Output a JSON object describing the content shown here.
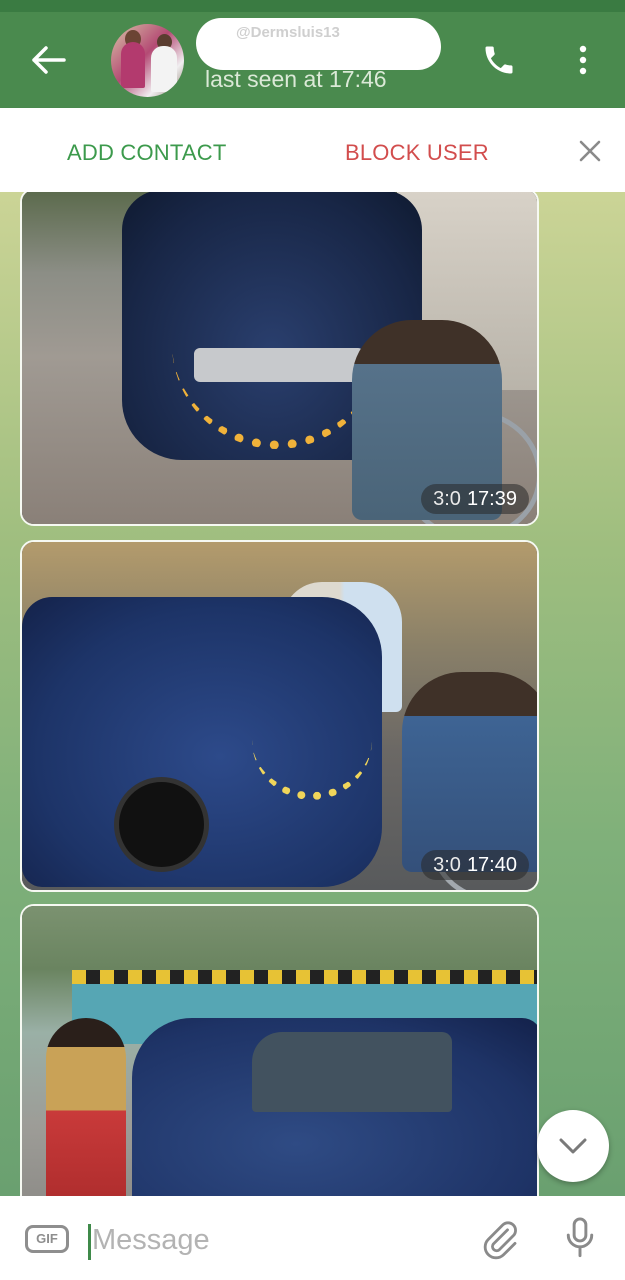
{
  "header": {
    "contact_name": "@Dermsluis13",
    "last_seen": "last seen at 17:46"
  },
  "action_bar": {
    "add_contact": "ADD CONTACT",
    "block_user": "BLOCK USER"
  },
  "messages": [
    {
      "type": "video",
      "duration": "3:0",
      "time": "17:39"
    },
    {
      "type": "video",
      "duration": "3:0",
      "time": "17:40"
    },
    {
      "type": "photo"
    }
  ],
  "composer": {
    "gif_label": "GIF",
    "placeholder": "Message"
  },
  "colors": {
    "header_bg": "#4a8a4e",
    "add_contact": "#3c9a4c",
    "block_user": "#d24d4d"
  },
  "icons": [
    "back-arrow-icon",
    "phone-icon",
    "more-vert-icon",
    "close-icon",
    "chevron-down-icon",
    "gif-icon",
    "paperclip-icon",
    "microphone-icon"
  ]
}
